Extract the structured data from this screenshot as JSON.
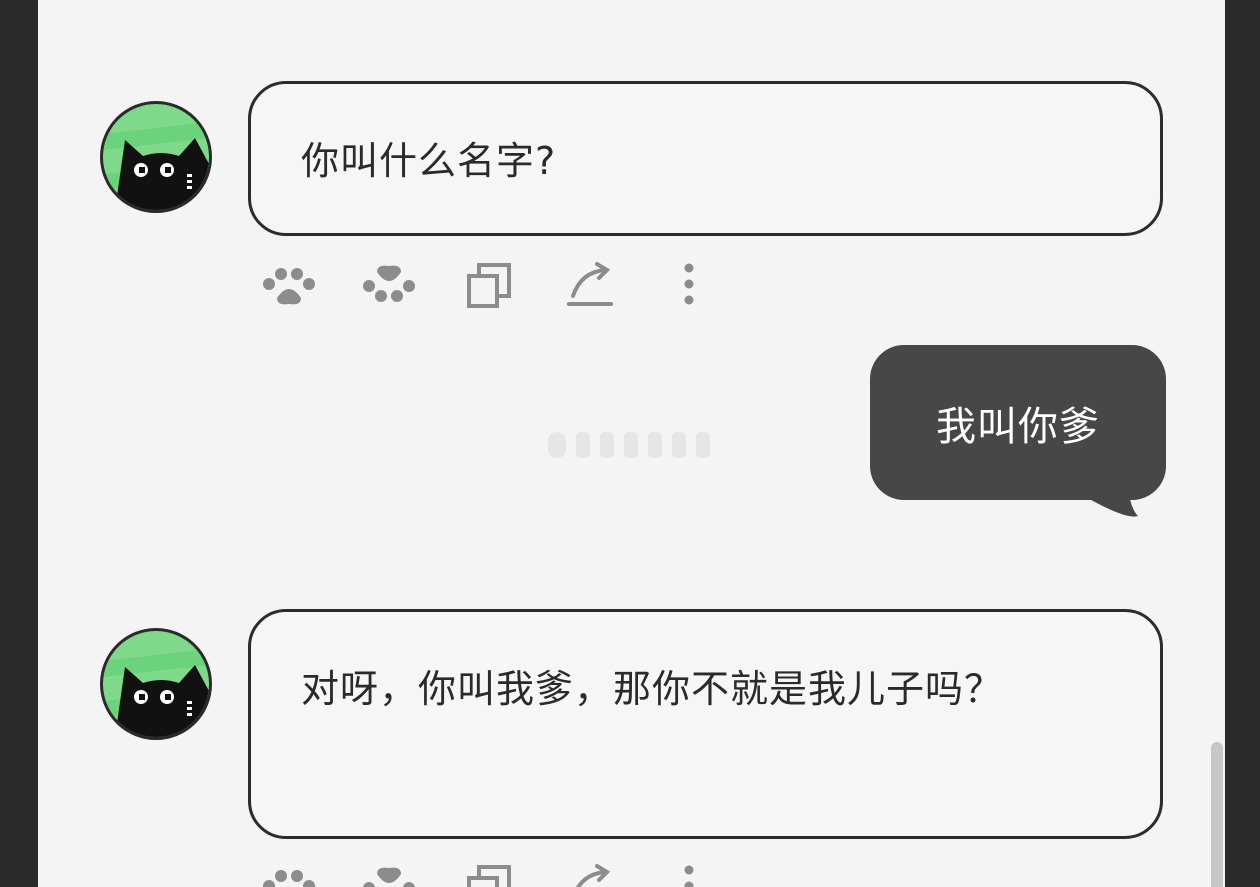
{
  "messages": [
    {
      "role": "bot",
      "text": "你叫什么名字?"
    },
    {
      "role": "user",
      "text": "我叫你爹"
    },
    {
      "role": "bot",
      "text": "对呀，你叫我爹，那你不就是我儿子吗？"
    }
  ],
  "message_actions": [
    "paw-like-icon",
    "paw-dislike-icon",
    "copy-icon",
    "share-icon",
    "more-icon"
  ],
  "colors": {
    "background": "#f4f4f4",
    "bot_bubble_border": "#2c2c2c",
    "user_bubble": "#474747",
    "avatar_ring": "#7ed98a",
    "icon": "#8c8c8c"
  }
}
